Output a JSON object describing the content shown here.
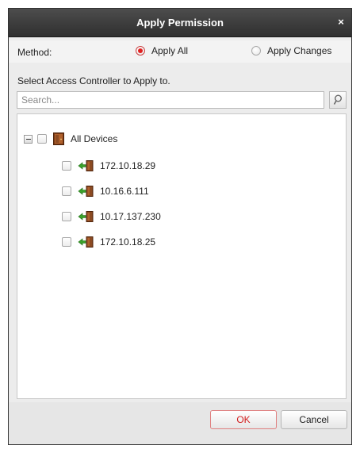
{
  "dialog": {
    "title": "Apply Permission",
    "close_label": "×"
  },
  "method": {
    "label": "Method:",
    "options": [
      {
        "label": "Apply All",
        "selected": true
      },
      {
        "label": "Apply Changes",
        "selected": false
      }
    ]
  },
  "section_label": "Select Access Controller to Apply to.",
  "search": {
    "placeholder": "Search...",
    "value": ""
  },
  "tree": {
    "root": {
      "label": "All Devices",
      "expanded": true,
      "checked": false,
      "icon": "door-group-icon"
    },
    "children": [
      {
        "label": "172.10.18.29",
        "checked": false,
        "icon": "door-controller-icon"
      },
      {
        "label": "10.16.6.111",
        "checked": false,
        "icon": "door-controller-icon"
      },
      {
        "label": "10.17.137.230",
        "checked": false,
        "icon": "door-controller-icon"
      },
      {
        "label": "172.10.18.25",
        "checked": false,
        "icon": "door-controller-icon"
      }
    ]
  },
  "buttons": {
    "ok_label": "OK",
    "cancel_label": "Cancel"
  },
  "colors": {
    "accent": "#d21e1e",
    "titlebar": "#3a3a3a",
    "door_green": "#3aa22a",
    "door_brown": "#8b4a22"
  }
}
